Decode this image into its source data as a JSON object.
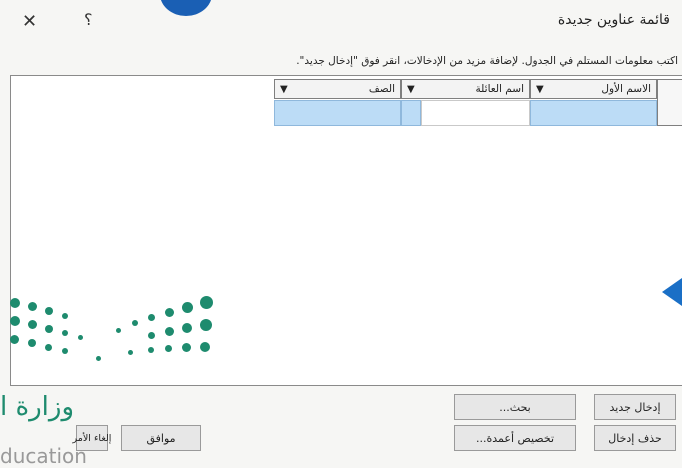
{
  "window": {
    "title": "قائمة عناوين جديدة",
    "close_glyph": "✕",
    "help_glyph": "؟"
  },
  "instructions": "اكتب معلومات المستلم في الجدول.  لإضافة مزيد من الإدخالات، انقر فوق \"إدخال جديد\".",
  "table": {
    "columns": [
      {
        "label": "الاسم الأول",
        "arrow": "▼"
      },
      {
        "label": "اسم العائلة",
        "arrow": "▼"
      },
      {
        "label": "الصف",
        "arrow": "▼"
      }
    ]
  },
  "buttons": {
    "new_entry": "إدخال جديد",
    "find": "بحث...",
    "delete_entry": "حذف إدخال",
    "customize_columns": "تخصيص أعمدة...",
    "ok": "موافق",
    "cancel": "إلغاء الأمر"
  },
  "logo": {
    "arabic_text": "وزارة ا",
    "english_text": "ducation"
  },
  "colors": {
    "accent": "#1a5fb4",
    "logo_green": "#1e8b6e",
    "selected_cell": "#bcdcf6"
  }
}
